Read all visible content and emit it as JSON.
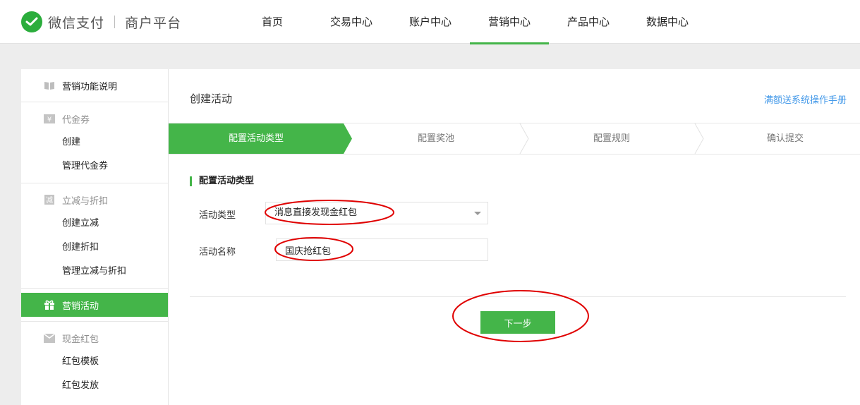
{
  "header": {
    "brand_name": "微信支付",
    "brand_sub": "商户平台",
    "nav": [
      {
        "label": "首页"
      },
      {
        "label": "交易中心"
      },
      {
        "label": "账户中心"
      },
      {
        "label": "营销中心",
        "active": true
      },
      {
        "label": "产品中心"
      },
      {
        "label": "数据中心"
      }
    ]
  },
  "sidebar": {
    "intro": "营销功能说明",
    "voucher": {
      "title": "代金券",
      "items": [
        "创建",
        "管理代金券"
      ]
    },
    "discount": {
      "title": "立减与折扣",
      "items": [
        "创建立减",
        "创建折扣",
        "管理立减与折扣"
      ]
    },
    "activity": {
      "title": "营销活动",
      "active": true
    },
    "redpack": {
      "title": "现金红包",
      "items": [
        "红包模板",
        "红包发放"
      ]
    },
    "icons": [
      "book-icon",
      "yuan-icon",
      "minus-badge-icon",
      "gift-icon",
      "envelope-icon"
    ]
  },
  "main": {
    "title": "创建活动",
    "manual_link": "满额送系统操作手册",
    "steps": [
      "配置活动类型",
      "配置奖池",
      "配置规则",
      "确认提交"
    ],
    "active_step": 0,
    "section_title": "配置活动类型",
    "form": {
      "type_label": "活动类型",
      "type_value": "消息直接发现金红包",
      "name_label": "活动名称",
      "name_value": "国庆抢红包"
    },
    "next_button": "下一步"
  },
  "colors": {
    "accent": "#44b549",
    "link": "#459ae9",
    "annotation": "#e00000"
  }
}
